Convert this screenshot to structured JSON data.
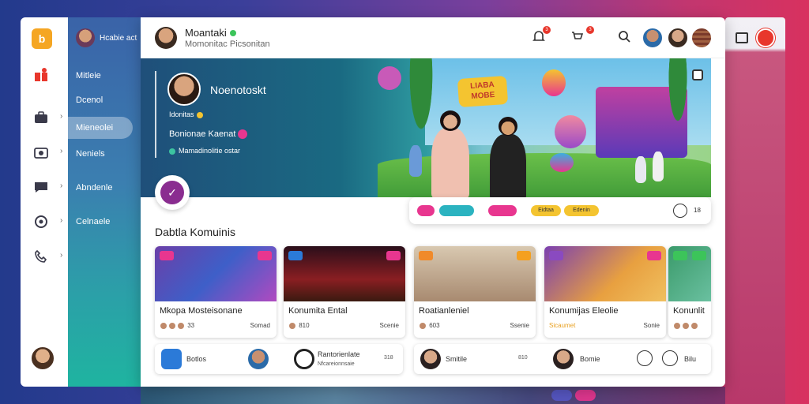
{
  "sidebar": {
    "header_title": "Hcabie act",
    "items": [
      {
        "label": "Mitleie"
      },
      {
        "label": "Dcenol"
      },
      {
        "label": "Mieneolei"
      },
      {
        "label": "Neniels"
      },
      {
        "label": "Abndenle"
      },
      {
        "label": "Celnaele"
      }
    ]
  },
  "topbar": {
    "profile_name": "Moantaki",
    "profile_subtitle": "Momonitac Picsonitan",
    "notifications": [
      {
        "count": "3"
      },
      {
        "count": "3"
      }
    ]
  },
  "hero": {
    "name": "Noenotoskt",
    "line1": "Idonitas",
    "line2": "Bonionae Kaenat",
    "line3": "Mamadinolitie ostar",
    "sign_text": "LIABA MOBE"
  },
  "filters": {
    "chips": [
      {
        "color": "#e8368f"
      },
      {
        "color": "#2bb3c0"
      },
      {
        "color": "#e8368f"
      },
      {
        "label": "Eidtaa",
        "color": "#f4c430"
      },
      {
        "label": "Edenin",
        "color": "#f4c430"
      }
    ],
    "extra_text": "18"
  },
  "section": {
    "title": "Dabtla Komuinis"
  },
  "cards": [
    {
      "title": "Mkopa Mosteisonane",
      "meta_left": "33",
      "meta_right": "Somad",
      "thumb": "linear-gradient(135deg,#6b3fa8,#3e5fc8 50%,#b04ac0)",
      "tag_l": "#e8368f",
      "tag_r": "#e8368f"
    },
    {
      "title": "Konumita Ental",
      "meta_left": "810",
      "meta_right": "Scenie",
      "thumb": "linear-gradient(180deg,#2a0e1a,#8a1e22 60%,#3a1a10)",
      "tag_l": "#2b7ad8",
      "tag_r": "#e8368f"
    },
    {
      "title": "Roatianleniel",
      "meta_left": "603",
      "meta_right": "Ssenie",
      "thumb": "linear-gradient(180deg,#d8c8b0,#a88a70)",
      "tag_l": "#f08a2a",
      "tag_r": "#f4a020"
    },
    {
      "title": "Konumijas Eleolie",
      "meta_left": "Sicaumet",
      "meta_right": "Sonie",
      "thumb": "linear-gradient(135deg,#7a3fb0,#e8a040 60%,#f0c060)",
      "tag_l": "#8a4ac0",
      "tag_r": "#e8368f"
    },
    {
      "title": "Konunlit",
      "meta_left": "",
      "meta_right": "",
      "thumb": "linear-gradient(135deg,#3a9a6a,#6ac0a0)",
      "tag_l": "#3cc45a",
      "tag_r": "#3cc45a"
    }
  ],
  "list_rows": [
    {
      "text": "Botlos"
    },
    {
      "text": "Rantorienlate",
      "sub": "Nfcareionnsaie",
      "badge": "318"
    },
    {
      "text": "Smitile",
      "badge": "810"
    },
    {
      "text": "Bomie"
    },
    {
      "text": "Bilu"
    }
  ],
  "colors": {
    "accent": "#8a2d90",
    "sidebar_top": "#3a63a8",
    "sidebar_bottom": "#1fb4a0",
    "logo": "#f5a623"
  },
  "icons": [
    "grid-icon",
    "gift-icon",
    "chevron-right-icon",
    "camera-icon",
    "chat-icon",
    "support-icon",
    "phone-icon",
    "bell-icon",
    "cart-icon",
    "search-icon",
    "fullscreen-icon",
    "clock-icon",
    "check-icon"
  ]
}
